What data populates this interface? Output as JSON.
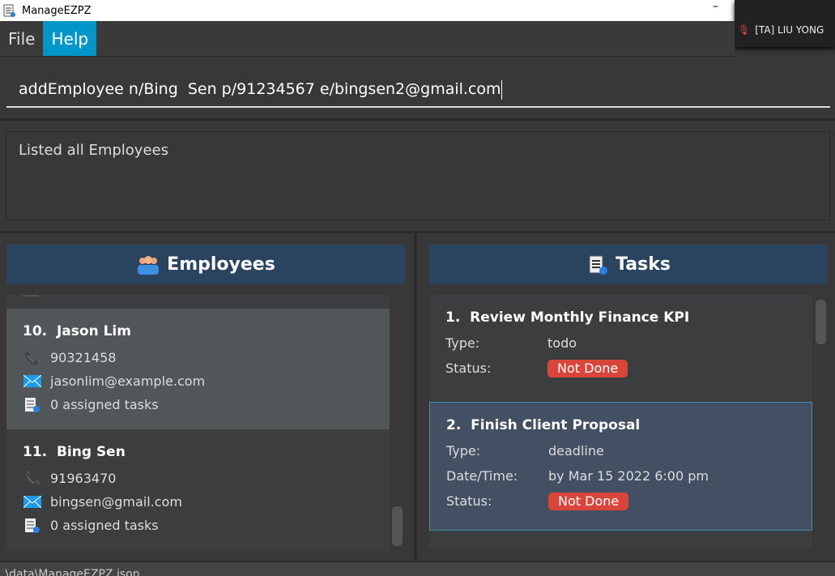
{
  "window": {
    "title": "ManageEZPZ",
    "minimize": "–"
  },
  "overlay": {
    "label": "[TA] LIU YONG"
  },
  "menu": {
    "file": "File",
    "help": "Help"
  },
  "command": {
    "value": "addEmployee n/Bing  Sen p/91234567 e/bingsen2@gmail.com"
  },
  "result": {
    "text": "Listed all Employees"
  },
  "employees": {
    "header": "Employees",
    "items": [
      {
        "index": "10.",
        "name": "Jason Lim",
        "phone": "90321458",
        "email": "jasonlim@example.com",
        "tasks": "0 assigned tasks"
      },
      {
        "index": "11.",
        "name": "Bing Sen",
        "phone": "91963470",
        "email": "bingsen@gmail.com",
        "tasks": "0 assigned tasks"
      }
    ]
  },
  "tasks": {
    "header": "Tasks",
    "labels": {
      "type": "Type:",
      "datetime": "Date/Time:",
      "status": "Status:"
    },
    "items": [
      {
        "index": "1.",
        "title": "Review Monthly Finance KPI",
        "type": "todo",
        "status": "Not Done"
      },
      {
        "index": "2.",
        "title": "Finish Client Proposal",
        "type": "deadline",
        "datetime": "by Mar 15 2022 6:00 pm",
        "status": "Not Done"
      }
    ]
  },
  "statusbar": {
    "path": ".\\data\\ManageEZPZ.json"
  },
  "colors": {
    "accent": "#0096c9",
    "header": "#2a4460",
    "selected": "#515658",
    "badge": "#d9453a"
  }
}
